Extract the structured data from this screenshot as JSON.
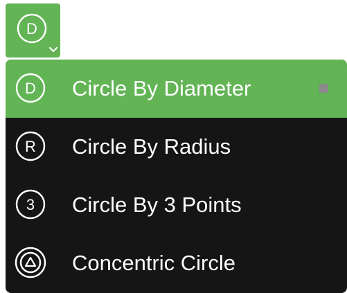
{
  "tool_button": {
    "icon": "circle-diameter-icon",
    "icon_letter": "D",
    "dropdown_icon": "chevron-down-icon",
    "color": "#62b455"
  },
  "menu": {
    "background": "#151515",
    "items": [
      {
        "label": "Circle By Diameter",
        "icon": "circle-diameter-icon",
        "icon_letter": "D",
        "selected": true
      },
      {
        "label": "Circle By Radius",
        "icon": "circle-radius-icon",
        "icon_letter": "R",
        "selected": false
      },
      {
        "label": "Circle By 3 Points",
        "icon": "circle-3-points-icon",
        "icon_letter": "3",
        "selected": false
      },
      {
        "label": "Concentric Circle",
        "icon": "concentric-circle-icon",
        "icon_letter": "",
        "selected": false
      }
    ]
  }
}
